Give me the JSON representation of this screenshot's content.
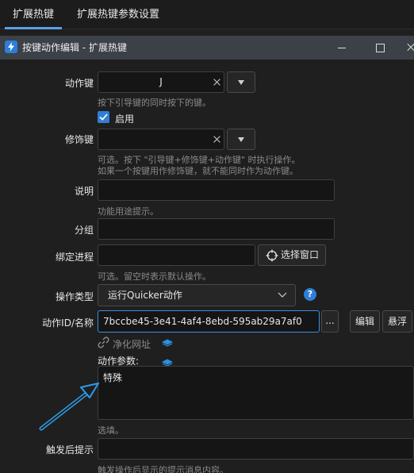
{
  "tabs": [
    {
      "label": "扩展热键"
    },
    {
      "label": "扩展热键参数设置"
    }
  ],
  "dialog": {
    "title": "按键动作编辑 - 扩展热键"
  },
  "form": {
    "action_key": {
      "label": "动作键",
      "value": "J",
      "hint": "按下引导键的同时按下的键。"
    },
    "enable": {
      "label": "启用",
      "checked": true
    },
    "modifier_key": {
      "label": "修饰键",
      "value": "",
      "hint_line1": "可选。按下 \"引导键+修饰键+动作键\" 时执行操作。",
      "hint_line2": "如果一个按键用作修饰键，就不能同时作为动作键。"
    },
    "description": {
      "label": "说明",
      "value": "",
      "hint": "功能用途提示。"
    },
    "group": {
      "label": "分组",
      "value": ""
    },
    "bind_process": {
      "label": "绑定进程",
      "value": "",
      "select_window_label": "选择窗口",
      "hint": "可选。留空时表示默认操作。"
    },
    "action_type": {
      "label": "操作类型",
      "value": "运行Quicker动作"
    },
    "action_id": {
      "label": "动作ID/名称",
      "value": "7bccbe45-3e41-4af4-8ebd-595ab29a7af0",
      "more_label": "...",
      "edit_label": "编辑",
      "float_label": "悬浮",
      "clean_url_label": "净化网址"
    },
    "action_params": {
      "label": "动作参数:",
      "value": "特殊",
      "hint": "选填。"
    },
    "after_trigger": {
      "label": "触发后提示",
      "value": "",
      "hint": "触发操作后显示的提示消息内容。"
    }
  },
  "colors": {
    "accent": "#2f7fd8",
    "arrow": "#2e9be8"
  }
}
